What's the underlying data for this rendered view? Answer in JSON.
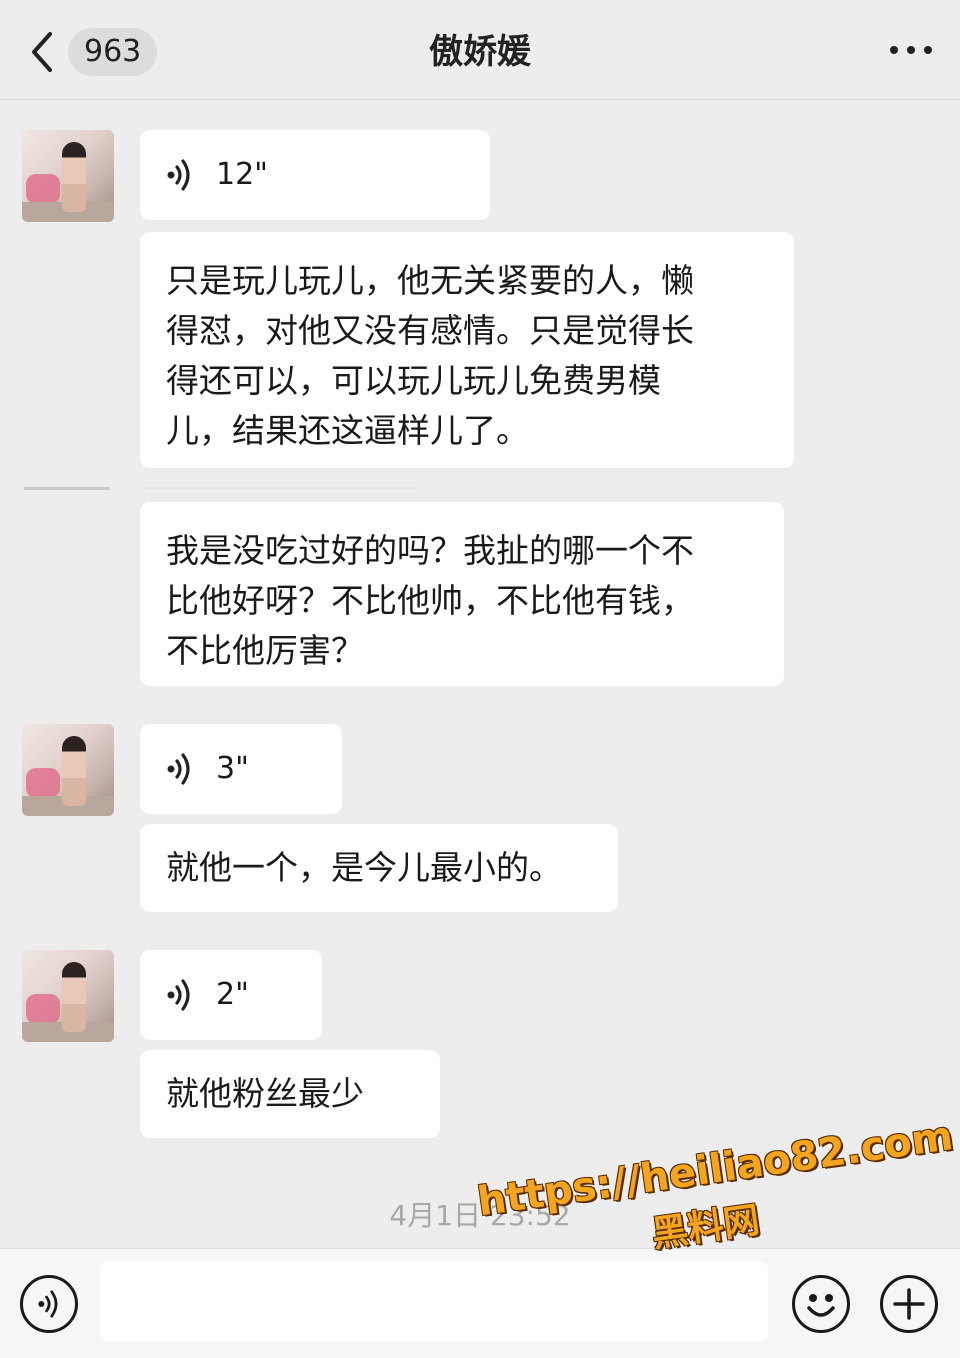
{
  "header": {
    "back_label": "963",
    "title": "傲娇媛"
  },
  "messages": [
    {
      "type": "voice",
      "duration": "12\""
    },
    {
      "type": "text",
      "text": "只是玩儿玩儿，他无关紧要的人，懒\n得怼，对他又没有感情。只是觉得长\n得还可以，可以玩儿玩儿免费男模\n儿，结果还这逼样儿了。"
    },
    {
      "type": "text",
      "text": "我是没吃过好的吗？我扯的哪一个不\n比他好呀？不比他帅，不比他有钱，\n不比他厉害？"
    },
    {
      "type": "voice",
      "duration": "3\""
    },
    {
      "type": "text",
      "text": "就他一个，是今儿最小的。"
    },
    {
      "type": "voice",
      "duration": "2\""
    },
    {
      "type": "text",
      "text": "就他粉丝最少"
    }
  ],
  "timestamp": "4月1日 23:52",
  "watermark": {
    "url": "https://heiliao82.com",
    "name": "黑料网"
  },
  "input": {
    "placeholder": ""
  },
  "colors": {
    "background": "#ededed",
    "bubble": "#ffffff",
    "watermark": "#f4a520"
  }
}
